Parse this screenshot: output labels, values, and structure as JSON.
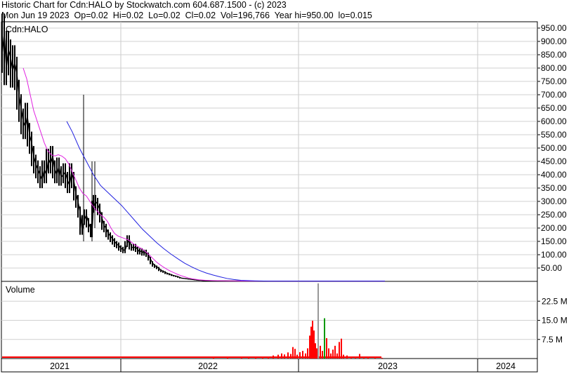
{
  "header": {
    "line1": "Historic Chart for Cdn:HALO by Stockwatch.com 604.687.1500 - (c) 2023",
    "line2": "Mon Jun 19 2023  Op=0.02  Hi=0.02  Lo=0.02  Cl=0.02  Vol=196,766  Year hi=950.00  lo=0.015"
  },
  "chart_data": [
    {
      "type": "ohlc",
      "title": "Cdn:HALO",
      "ylim": [
        0,
        1000
      ],
      "y_ticks": [
        50,
        100,
        150,
        200,
        250,
        300,
        350,
        400,
        450,
        500,
        550,
        600,
        650,
        700,
        750,
        800,
        850,
        900,
        950
      ],
      "y_tick_labels": [
        "50.00",
        "100.00",
        "150.00",
        "200.00",
        "250.00",
        "300.00",
        "350.00",
        "400.00",
        "450.00",
        "500.00",
        "550.00",
        "600.00",
        "650.00",
        "700.00",
        "750.00",
        "800.00",
        "850.00",
        "900.00",
        "950.00"
      ],
      "x_labels": [
        "2021",
        "2022",
        "2023",
        "2024"
      ],
      "grid": true,
      "price_series": {
        "name": "",
        "color": "#000000",
        "points": [
          [
            0,
            850
          ],
          [
            3,
            930
          ],
          [
            6,
            800
          ],
          [
            9,
            870
          ],
          [
            12,
            840
          ],
          [
            15,
            790
          ],
          [
            18,
            820
          ],
          [
            21,
            780
          ],
          [
            24,
            700
          ],
          [
            27,
            650
          ],
          [
            30,
            600
          ],
          [
            33,
            580
          ],
          [
            36,
            620
          ],
          [
            39,
            550
          ],
          [
            42,
            520
          ],
          [
            45,
            470
          ],
          [
            48,
            440
          ],
          [
            51,
            420
          ],
          [
            54,
            400
          ],
          [
            57,
            380
          ],
          [
            60,
            420
          ],
          [
            63,
            400
          ],
          [
            66,
            460
          ],
          [
            69,
            440
          ],
          [
            72,
            470
          ],
          [
            75,
            420
          ],
          [
            78,
            400
          ],
          [
            81,
            430
          ],
          [
            84,
            390
          ],
          [
            87,
            400
          ],
          [
            90,
            410
          ],
          [
            93,
            380
          ],
          [
            96,
            360
          ],
          [
            99,
            410
          ],
          [
            102,
            380
          ],
          [
            105,
            330
          ],
          [
            108,
            300
          ],
          [
            111,
            260
          ],
          [
            114,
            190
          ],
          [
            117,
            230
          ],
          [
            120,
            250
          ],
          [
            123,
            220
          ],
          [
            126,
            200
          ],
          [
            128,
            180
          ],
          [
            130,
            280
          ],
          [
            133,
            300
          ],
          [
            136,
            290
          ],
          [
            139,
            270
          ],
          [
            142,
            240
          ],
          [
            145,
            210
          ],
          [
            148,
            200
          ],
          [
            151,
            180
          ],
          [
            154,
            170
          ],
          [
            157,
            160
          ],
          [
            160,
            150
          ],
          [
            163,
            140
          ],
          [
            166,
            135
          ],
          [
            169,
            125
          ],
          [
            172,
            120
          ],
          [
            175,
            115
          ],
          [
            178,
            140
          ],
          [
            181,
            160
          ],
          [
            184,
            130
          ],
          [
            187,
            125
          ],
          [
            190,
            130
          ],
          [
            193,
            120
          ],
          [
            196,
            110
          ],
          [
            199,
            115
          ],
          [
            202,
            105
          ],
          [
            205,
            110
          ],
          [
            208,
            100
          ],
          [
            211,
            85
          ],
          [
            214,
            70
          ],
          [
            217,
            60
          ],
          [
            220,
            55
          ],
          [
            223,
            50
          ],
          [
            226,
            42
          ],
          [
            229,
            38
          ],
          [
            232,
            35
          ],
          [
            235,
            30
          ],
          [
            238,
            28
          ],
          [
            241,
            25
          ],
          [
            244,
            22
          ],
          [
            247,
            20
          ],
          [
            250,
            18
          ],
          [
            253,
            15
          ],
          [
            256,
            12
          ],
          [
            259,
            11
          ],
          [
            262,
            10
          ],
          [
            265,
            9
          ],
          [
            268,
            8
          ],
          [
            271,
            7
          ],
          [
            274,
            6
          ],
          [
            277,
            5
          ],
          [
            280,
            4
          ],
          [
            283,
            4
          ],
          [
            286,
            3
          ],
          [
            290,
            3
          ],
          [
            300,
            2
          ],
          [
            320,
            2
          ],
          [
            360,
            1
          ],
          [
            420,
            1
          ],
          [
            480,
            1
          ],
          [
            545,
            1
          ]
        ]
      },
      "ma_short": {
        "name": "",
        "color": "#e020e0",
        "points": [
          [
            30,
            800
          ],
          [
            35,
            760
          ],
          [
            40,
            700
          ],
          [
            45,
            640
          ],
          [
            50,
            600
          ],
          [
            55,
            560
          ],
          [
            60,
            520
          ],
          [
            65,
            490
          ],
          [
            70,
            475
          ],
          [
            75,
            470
          ],
          [
            80,
            475
          ],
          [
            85,
            470
          ],
          [
            90,
            460
          ],
          [
            95,
            440
          ],
          [
            100,
            410
          ],
          [
            105,
            380
          ],
          [
            110,
            350
          ],
          [
            115,
            330
          ],
          [
            120,
            320
          ],
          [
            125,
            300
          ],
          [
            130,
            280
          ],
          [
            135,
            265
          ],
          [
            140,
            250
          ],
          [
            145,
            240
          ],
          [
            150,
            225
          ],
          [
            155,
            200
          ],
          [
            160,
            180
          ],
          [
            165,
            170
          ],
          [
            170,
            165
          ],
          [
            175,
            160
          ],
          [
            180,
            155
          ],
          [
            185,
            145
          ],
          [
            190,
            135
          ],
          [
            195,
            128
          ],
          [
            200,
            120
          ],
          [
            205,
            110
          ],
          [
            210,
            98
          ],
          [
            215,
            85
          ],
          [
            220,
            72
          ],
          [
            225,
            62
          ],
          [
            230,
            53
          ],
          [
            235,
            45
          ],
          [
            240,
            38
          ],
          [
            245,
            32
          ],
          [
            250,
            26
          ],
          [
            255,
            21
          ],
          [
            260,
            17
          ],
          [
            265,
            13
          ],
          [
            270,
            10
          ],
          [
            275,
            8
          ],
          [
            280,
            6
          ],
          [
            285,
            5
          ],
          [
            290,
            4
          ],
          [
            300,
            3
          ],
          [
            320,
            2
          ],
          [
            360,
            1
          ],
          [
            420,
            1
          ],
          [
            545,
            1
          ]
        ]
      },
      "ma_long": {
        "name": "",
        "color": "#2020e0",
        "points": [
          [
            92,
            600
          ],
          [
            100,
            560
          ],
          [
            110,
            500
          ],
          [
            120,
            450
          ],
          [
            130,
            400
          ],
          [
            140,
            360
          ],
          [
            150,
            335
          ],
          [
            160,
            310
          ],
          [
            170,
            285
          ],
          [
            180,
            255
          ],
          [
            190,
            225
          ],
          [
            200,
            195
          ],
          [
            210,
            170
          ],
          [
            220,
            145
          ],
          [
            230,
            123
          ],
          [
            240,
            103
          ],
          [
            250,
            85
          ],
          [
            260,
            68
          ],
          [
            270,
            54
          ],
          [
            280,
            42
          ],
          [
            290,
            32
          ],
          [
            300,
            24
          ],
          [
            310,
            17
          ],
          [
            320,
            11
          ],
          [
            330,
            7
          ],
          [
            340,
            4
          ],
          [
            350,
            3
          ],
          [
            360,
            2
          ],
          [
            380,
            1
          ],
          [
            420,
            1
          ],
          [
            545,
            1
          ]
        ]
      }
    },
    {
      "type": "bar",
      "title": "Volume",
      "ylim": [
        0,
        30
      ],
      "y_ticks": [
        7.5,
        15.0,
        22.5
      ],
      "y_tick_labels": [
        "7.5 M",
        "15.0 M",
        "22.5 M"
      ],
      "bars": [
        {
          "x": 300,
          "value": 0.3,
          "color": "#ff0000"
        },
        {
          "x": 320,
          "value": 0.3,
          "color": "#ff0000"
        },
        {
          "x": 340,
          "value": 0.4,
          "color": "#ff0000"
        },
        {
          "x": 350,
          "value": 0.8,
          "color": "#ff0000"
        },
        {
          "x": 360,
          "value": 0.7,
          "color": "#ff0000"
        },
        {
          "x": 370,
          "value": 0.7,
          "color": "#ff0000"
        },
        {
          "x": 378,
          "value": 0.6,
          "color": "#ff0000"
        },
        {
          "x": 385,
          "value": 1.2,
          "color": "#ff0000"
        },
        {
          "x": 392,
          "value": 1.5,
          "color": "#ff0000"
        },
        {
          "x": 397,
          "value": 2.0,
          "color": "#ff0000"
        },
        {
          "x": 401,
          "value": 1.6,
          "color": "#ff0000"
        },
        {
          "x": 406,
          "value": 2.4,
          "color": "#ff0000"
        },
        {
          "x": 410,
          "value": 1.8,
          "color": "#ff0000"
        },
        {
          "x": 413,
          "value": 4.5,
          "color": "#ff0000"
        },
        {
          "x": 416,
          "value": 3.8,
          "color": "#ff0000"
        },
        {
          "x": 419,
          "value": 1.5,
          "color": "#ff0000"
        },
        {
          "x": 423,
          "value": 2.5,
          "color": "#ff0000"
        },
        {
          "x": 427,
          "value": 3.0,
          "color": "#ff0000"
        },
        {
          "x": 431,
          "value": 2.0,
          "color": "#ff0000"
        },
        {
          "x": 434,
          "value": 4.0,
          "color": "#ff0000"
        },
        {
          "x": 437,
          "value": 9.0,
          "color": "#ff0000"
        },
        {
          "x": 439,
          "value": 12.5,
          "color": "#ff0000"
        },
        {
          "x": 441,
          "value": 14.8,
          "color": "#ff0000"
        },
        {
          "x": 443,
          "value": 11.0,
          "color": "#ff0000"
        },
        {
          "x": 445,
          "value": 6.0,
          "color": "#ff0000"
        },
        {
          "x": 447,
          "value": 4.0,
          "color": "#ff0000"
        },
        {
          "x": 449,
          "value": 29.5,
          "color": "#999999"
        },
        {
          "x": 452,
          "value": 5.0,
          "color": "#ff0000"
        },
        {
          "x": 455,
          "value": 3.0,
          "color": "#ff0000"
        },
        {
          "x": 458,
          "value": 15.8,
          "color": "#009900"
        },
        {
          "x": 461,
          "value": 8.0,
          "color": "#ff0000"
        },
        {
          "x": 464,
          "value": 4.0,
          "color": "#ff0000"
        },
        {
          "x": 467,
          "value": 2.0,
          "color": "#ff0000"
        },
        {
          "x": 470,
          "value": 3.5,
          "color": "#ff0000"
        },
        {
          "x": 473,
          "value": 5.0,
          "color": "#ff0000"
        },
        {
          "x": 476,
          "value": 2.0,
          "color": "#ff0000"
        },
        {
          "x": 479,
          "value": 6.5,
          "color": "#ff0000"
        },
        {
          "x": 482,
          "value": 7.8,
          "color": "#ff0000"
        },
        {
          "x": 485,
          "value": 1.5,
          "color": "#ff0000"
        },
        {
          "x": 490,
          "value": 1.2,
          "color": "#ff0000"
        },
        {
          "x": 496,
          "value": 0.8,
          "color": "#ff0000"
        },
        {
          "x": 502,
          "value": 0.6,
          "color": "#ff0000"
        },
        {
          "x": 508,
          "value": 1.8,
          "color": "#ff0000"
        },
        {
          "x": 514,
          "value": 0.7,
          "color": "#ff0000"
        },
        {
          "x": 520,
          "value": 0.4,
          "color": "#ff0000"
        },
        {
          "x": 530,
          "value": 0.4,
          "color": "#ff0000"
        },
        {
          "x": 540,
          "value": 0.3,
          "color": "#ff0000"
        }
      ]
    }
  ]
}
